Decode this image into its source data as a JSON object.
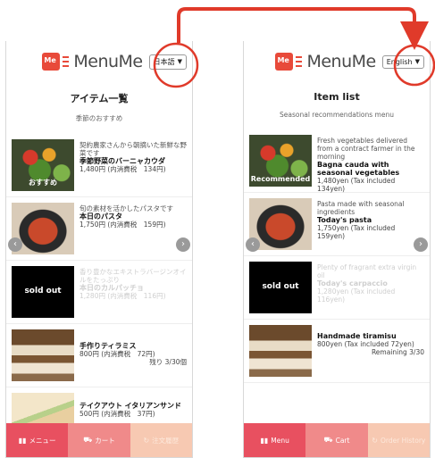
{
  "phones": {
    "ja": {
      "logo_brand": "MenuMe",
      "language_value": "日本語",
      "page_title": "アイテム一覧",
      "page_subtitle": "季節のおすすめ",
      "items": [
        {
          "badge": "おすすめ",
          "desc": "契約農家さんから朝摘いた新鮮な野菜です",
          "name": "季節野菜のバーニャカウダ",
          "price": "1,480円 (内消費税　134円)"
        },
        {
          "desc": "旬の素材を活かしたパスタです",
          "name": "本日のパスタ",
          "price": "1,750円 (内消費税　159円)"
        },
        {
          "soldout": "sold out",
          "desc": "香り豊かなエキストラバージンオイルをたっぷり",
          "name": "本日のカルパッチョ",
          "price": "1,280円 (内消費税　116円)"
        },
        {
          "name": "手作りティラミス",
          "price": "800円 (内消費税　72円)",
          "remain": "残り 3/30個"
        },
        {
          "name": "テイクアウト イタリアンサンド",
          "price": "500円 (内消費税　37円)"
        }
      ],
      "tabs": {
        "menu": "メニュー",
        "cart": "カート",
        "history": "注文履歴"
      }
    },
    "en": {
      "logo_brand": "MenuMe",
      "language_value": "English",
      "page_title": "Item list",
      "page_subtitle": "Seasonal recommendations menu",
      "items": [
        {
          "badge": "Recommended",
          "desc": "Fresh vegetables delivered from a contract farmer in the morning",
          "name": "Bagna cauda with seasonal vegetables",
          "price": "1,480yen (Tax included 134yen)"
        },
        {
          "desc": "Pasta made with seasonal ingredients",
          "name": "Today's pasta",
          "price": "1,750yen (Tax included 159yen)"
        },
        {
          "soldout": "sold out",
          "desc": "Plenty of fragrant extra virgin oil",
          "name": "Today's carpaccio",
          "price": "1,280yen (Tax included 116yen)"
        },
        {
          "name": "Handmade tiramisu",
          "price": "800yen (Tax included 72yen)",
          "remain": "Remaining  3/30"
        }
      ],
      "tabs": {
        "menu": "Menu",
        "cart": "Cart",
        "history": "Order History"
      }
    }
  },
  "colors": {
    "accent": "#e84a3a",
    "tab_menu": "#e85060",
    "tab_cart": "#f08a8a",
    "tab_history": "#f7c9b2"
  }
}
